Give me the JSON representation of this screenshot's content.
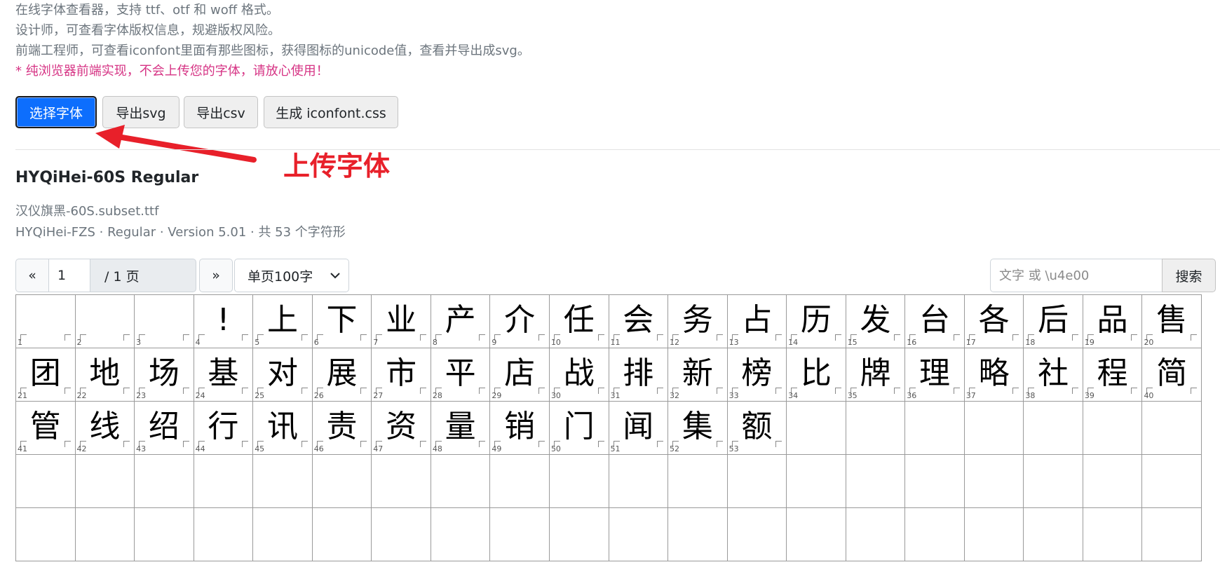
{
  "intro": {
    "lines": [
      "在线字体查看器，支持 ttf、otf 和 woff 格式。",
      "设计师，可查看字体版权信息，规避版权风险。",
      "前端工程师，可查看iconfont里面有那些图标，获得图标的unicode值，查看并导出成svg。"
    ],
    "warning": "* 纯浏览器前端实现，不会上传您的字体，请放心使用！"
  },
  "toolbar": {
    "choose_font": "选择字体",
    "export_svg": "导出svg",
    "export_csv": "导出csv",
    "generate_css": "生成 iconfont.css"
  },
  "annotation": {
    "label": "上传字体",
    "color": "#e8202a"
  },
  "font": {
    "title": "HYQiHei-60S Regular",
    "file": "汉仪旗黑-60S.subset.ttf",
    "meta": "HYQiHei-FZS · Regular · Version 5.01 · 共 53 个字符形"
  },
  "pager": {
    "prev": "«",
    "page": "1",
    "total": "/ 1 页",
    "next": "»",
    "per_page": "单页100字"
  },
  "search": {
    "placeholder": "文字 或 \\u4e00",
    "button": "搜索"
  },
  "glyphs": [
    "",
    "",
    "",
    "!",
    "上",
    "下",
    "业",
    "产",
    "介",
    "任",
    "会",
    "务",
    "占",
    "历",
    "发",
    "台",
    "各",
    "后",
    "品",
    "售",
    "团",
    "地",
    "场",
    "基",
    "对",
    "展",
    "市",
    "平",
    "店",
    "战",
    "排",
    "新",
    "榜",
    "比",
    "牌",
    "理",
    "略",
    "社",
    "程",
    "简",
    "管",
    "线",
    "绍",
    "行",
    "讯",
    "责",
    "资",
    "量",
    "销",
    "门",
    "闻",
    "集",
    "额"
  ],
  "grid_capacity": 100,
  "colors": {
    "primary": "#0d6efd",
    "warning_text": "#d63384",
    "muted_text": "#6c757d"
  }
}
